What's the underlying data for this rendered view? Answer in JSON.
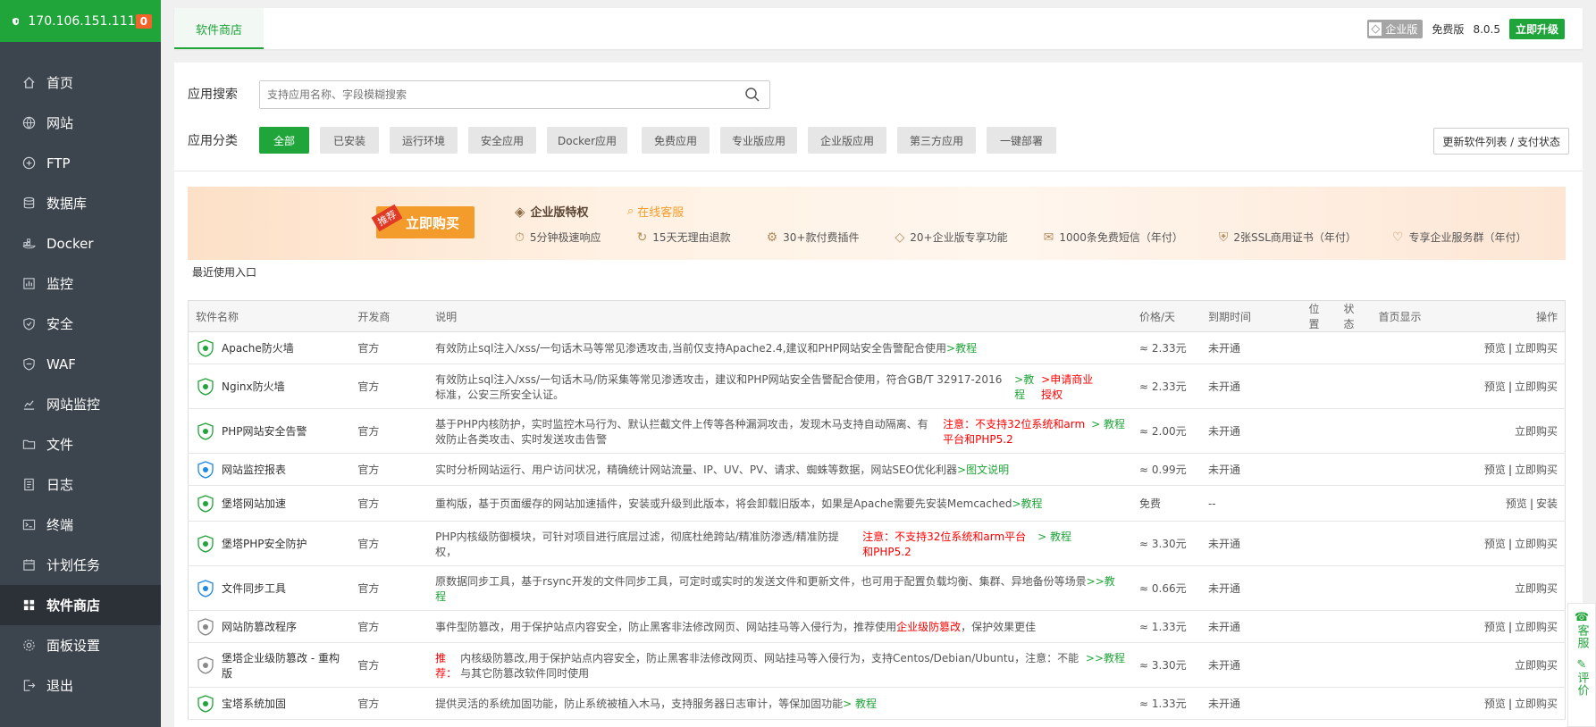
{
  "sidebar": {
    "ip": "170.106.151.111",
    "badge": "0",
    "items": [
      {
        "label": "首页",
        "icon": "home-icon"
      },
      {
        "label": "网站",
        "icon": "globe-icon"
      },
      {
        "label": "FTP",
        "icon": "ftp-icon"
      },
      {
        "label": "数据库",
        "icon": "database-icon"
      },
      {
        "label": "Docker",
        "icon": "docker-icon"
      },
      {
        "label": "监控",
        "icon": "monitor-icon"
      },
      {
        "label": "安全",
        "icon": "shield-icon"
      },
      {
        "label": "WAF",
        "icon": "waf-icon"
      },
      {
        "label": "网站监控",
        "icon": "chart-icon"
      },
      {
        "label": "文件",
        "icon": "folder-icon"
      },
      {
        "label": "日志",
        "icon": "log-icon"
      },
      {
        "label": "终端",
        "icon": "terminal-icon"
      },
      {
        "label": "计划任务",
        "icon": "task-icon"
      },
      {
        "label": "软件商店",
        "icon": "grid-icon"
      },
      {
        "label": "面板设置",
        "icon": "gear-icon"
      },
      {
        "label": "退出",
        "icon": "logout-icon"
      }
    ],
    "active_index": 13
  },
  "topbar": {
    "tab": "软件商店",
    "enterprise": "企业版",
    "free": "免费版",
    "version": "8.0.5",
    "upgrade": "立即升级"
  },
  "search": {
    "label": "应用搜索",
    "placeholder": "支持应用名称、字段模糊搜索"
  },
  "categories": {
    "label": "应用分类",
    "items": [
      "全部",
      "已安装",
      "运行环境",
      "安全应用",
      "Docker应用",
      "免费应用",
      "专业版应用",
      "企业版应用",
      "第三方应用",
      "一键部署"
    ],
    "active": 0,
    "refresh": "更新软件列表 / 支付状态"
  },
  "banner": {
    "tag": "推荐",
    "buy": "立即购买",
    "title": "企业版特权",
    "online": "在线客服",
    "features": [
      "5分钟极速响应",
      "15天无理由退款",
      "30+款付费插件",
      "20+企业版专享功能",
      "1000条免费短信（年付）",
      "2张SSL商用证书（年付）",
      "专享企业服务群（年付）"
    ]
  },
  "recent_label": "最近使用入口",
  "table": {
    "headers": [
      "软件名称",
      "开发商",
      "说明",
      "价格/天",
      "到期时间",
      "位置",
      "状态",
      "首页显示",
      "操作"
    ],
    "rows": [
      {
        "name": "Apache防火墙",
        "dev": "官方",
        "desc": "有效防止sql注入/xss/一句话木马等常见渗透攻击,当前仅支持Apache2.4,建议和PHP网站安全告警配合使用",
        "note": "",
        "link": ">教程",
        "link2": "",
        "price": "≈ 2.33元",
        "expire": "未开通",
        "preview": "预览",
        "action": "立即购买",
        "color": "#20a53a"
      },
      {
        "name": "Nginx防火墙",
        "dev": "官方",
        "desc": "有效防止sql注入/xss/一句话木马/防采集等常见渗透攻击，建议和PHP网站安全告警配合使用，符合GB/T 32917-2016标准，公安三所安全认证。",
        "note": "",
        "link": ">教程",
        "link2": ">申请商业授权",
        "price": "≈ 2.33元",
        "expire": "未开通",
        "preview": "预览",
        "action": "立即购买",
        "color": "#20a53a"
      },
      {
        "name": "PHP网站安全告警",
        "dev": "官方",
        "desc": "基于PHP内核防护，实时监控木马行为、默认拦截文件上传等各种漏洞攻击，发现木马支持自动隔离、有效防止各类攻击、实时发送攻击告警",
        "note": "注意：不支持32位系统和arm平台和PHP5.2",
        "link": "> 教程",
        "link2": "",
        "price": "≈ 2.00元",
        "expire": "未开通",
        "preview": "",
        "action": "立即购买",
        "color": "#20a53a"
      },
      {
        "name": "网站监控报表",
        "dev": "官方",
        "desc": "实时分析网站运行、用户访问状况，精确统计网站流量、IP、UV、PV、请求、蜘蛛等数据，网站SEO优化利器",
        "note": "",
        "link": ">图文说明",
        "link2": "",
        "price": "≈ 0.99元",
        "expire": "未开通",
        "preview": "预览",
        "action": "立即购买",
        "color": "#1e88e5"
      },
      {
        "name": "堡塔网站加速",
        "dev": "官方",
        "desc": "重构版，基于页面缓存的网站加速插件，安装或升级到此版本，将会卸载旧版本，如果是Apache需要先安装Memcached",
        "note": "",
        "link": ">教程",
        "link2": "",
        "price": "免费",
        "expire": "--",
        "preview": "预览",
        "action": "安装",
        "color": "#20a53a"
      },
      {
        "name": "堡塔PHP安全防护",
        "dev": "官方",
        "desc": "PHP内核级防御模块，可针对项目进行底层过滤，彻底杜绝跨站/精准防渗透/精准防提权，",
        "note": "注意：不支持32位系统和arm平台和PHP5.2",
        "link": "> 教程",
        "link2": "",
        "price": "≈ 3.30元",
        "expire": "未开通",
        "preview": "预览",
        "action": "立即购买",
        "color": "#20a53a"
      },
      {
        "name": "文件同步工具",
        "dev": "官方",
        "desc": "原数据同步工具，基于rsync开发的文件同步工具，可定时或实时的发送文件和更新文件，也可用于配置负载均衡、集群、异地备份等场景",
        "note": "",
        "link": ">>教程",
        "link2": "",
        "price": "≈ 0.66元",
        "expire": "未开通",
        "preview": "",
        "action": "立即购买",
        "color": "#1e88e5"
      },
      {
        "name": "网站防篡改程序",
        "dev": "官方",
        "desc": "事件型防篡改，用于保护站点内容安全，防止黑客非法修改网页、网站挂马等入侵行为，推荐使用",
        "note": "企业级防篡改",
        "desc_tail": "，保护效果更佳",
        "link": "",
        "link2": "",
        "price": "≈ 1.33元",
        "expire": "未开通",
        "preview": "预览",
        "action": "立即购买",
        "color": "#888"
      },
      {
        "name": "堡塔企业级防篡改 - 重构版",
        "dev": "官方",
        "desc": "内核级防篡改,用于保护站点内容安全，防止黑客非法修改网页、网站挂马等入侵行为，支持Centos/Debian/Ubuntu，注意：不能与其它防篡改软件同时使用",
        "note": "推荐：",
        "link": ">>教程",
        "link2": "",
        "price": "≈ 3.30元",
        "expire": "未开通",
        "preview": "",
        "action": "立即购买",
        "color": "#888"
      },
      {
        "name": "宝塔系统加固",
        "dev": "官方",
        "desc": "提供灵活的系统加固功能，防止系统被植入木马，支持服务器日志审计，等保加固功能",
        "note": "",
        "link": "> 教程",
        "link2": "",
        "price": "≈ 1.33元",
        "expire": "未开通",
        "preview": "预览",
        "action": "立即购买",
        "color": "#20a53a"
      }
    ]
  },
  "float": {
    "service": "客服",
    "review": "评价"
  }
}
